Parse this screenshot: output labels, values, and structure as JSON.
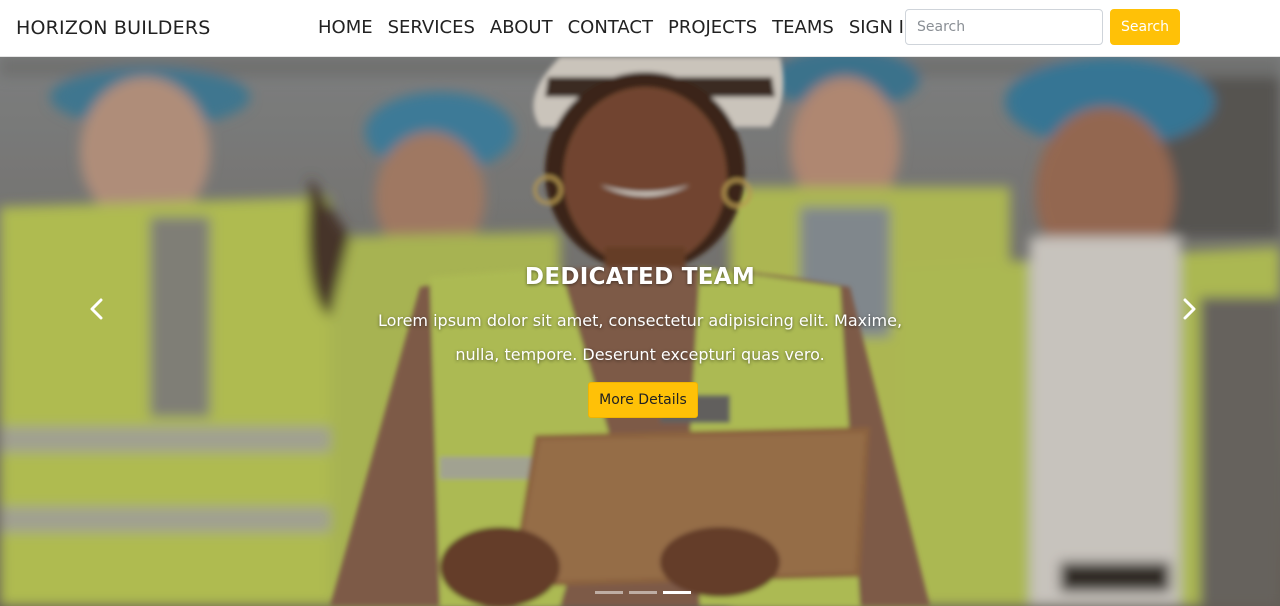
{
  "brand": "HORIZON BUILDERS",
  "nav": {
    "items": [
      {
        "label": "HOME"
      },
      {
        "label": "SERVICES"
      },
      {
        "label": "ABOUT"
      },
      {
        "label": "CONTACT"
      },
      {
        "label": "PROJECTS"
      },
      {
        "label": "TEAMS"
      },
      {
        "label": "SIGN IN"
      }
    ]
  },
  "search": {
    "placeholder": "Search",
    "button_label": "Search"
  },
  "hero": {
    "title": "DEDICATED TEAM",
    "text": "Lorem ipsum dolor sit amet, consectetur adipisicing elit. Maxime, nulla, tempore. Deserunt excepturi quas vero.",
    "button_label": "More Details",
    "prev_icon": "chevron-left-icon",
    "next_icon": "chevron-right-icon",
    "slide_count": 3,
    "active_slide": 3
  },
  "colors": {
    "accent": "#ffc107",
    "nav_text": "#222222",
    "caption_text": "#ffffff"
  }
}
